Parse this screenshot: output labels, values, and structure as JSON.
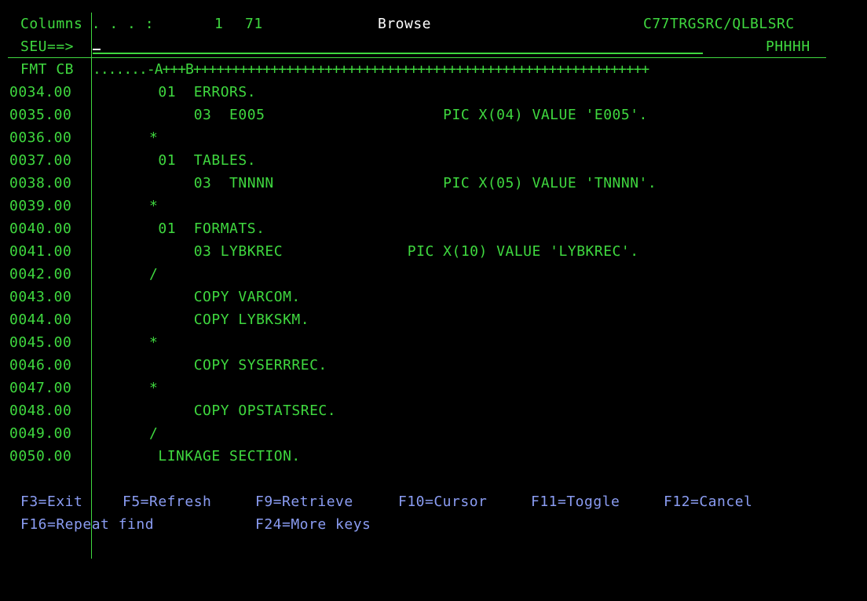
{
  "header": {
    "columns_label": "Columns . . . :",
    "columns_from": "1",
    "columns_to": "71",
    "mode": "Browse",
    "member": "C77TRGSRC/QLBLSRC",
    "command_prompt": "SEU==>",
    "command_value": "",
    "member_name": "PHHHH",
    "format_label": "FMT CB",
    "ruler": ".......-A+++B+++++++++++++++++++++++++++++++++++++++++++++++++++++++++++"
  },
  "source_lines": [
    {
      "seq": "0034.00",
      "text": "       01  ERRORS."
    },
    {
      "seq": "0035.00",
      "text": "           03  E005                    PIC X(04) VALUE 'E005'."
    },
    {
      "seq": "0036.00",
      "text": "      *"
    },
    {
      "seq": "0037.00",
      "text": "       01  TABLES."
    },
    {
      "seq": "0038.00",
      "text": "           03  TNNNN                   PIC X(05) VALUE 'TNNNN'."
    },
    {
      "seq": "0039.00",
      "text": "      *"
    },
    {
      "seq": "0040.00",
      "text": "       01  FORMATS."
    },
    {
      "seq": "0041.00",
      "text": "           03 LYBKREC              PIC X(10) VALUE 'LYBKREC'."
    },
    {
      "seq": "0042.00",
      "text": "      /"
    },
    {
      "seq": "0043.00",
      "text": "           COPY VARCOM."
    },
    {
      "seq": "0044.00",
      "text": "           COPY LYBKSKM."
    },
    {
      "seq": "0045.00",
      "text": "      *"
    },
    {
      "seq": "0046.00",
      "text": "           COPY SYSERRREC."
    },
    {
      "seq": "0047.00",
      "text": "      *"
    },
    {
      "seq": "0048.00",
      "text": "           COPY OPSTATSREC."
    },
    {
      "seq": "0049.00",
      "text": "      /"
    },
    {
      "seq": "0050.00",
      "text": "       LINKAGE SECTION."
    }
  ],
  "function_keys": {
    "f3": "F3=Exit",
    "f5": "F5=Refresh",
    "f9": "F9=Retrieve",
    "f10": "F10=Cursor",
    "f11": "F11=Toggle",
    "f12": "F12=Cancel",
    "f16": "F16=Repeat find",
    "f24": "F24=More keys"
  },
  "colors": {
    "background": "#000000",
    "text_green": "#3fd83f",
    "text_white": "#ffffff",
    "text_blue": "#8a9cf2"
  }
}
